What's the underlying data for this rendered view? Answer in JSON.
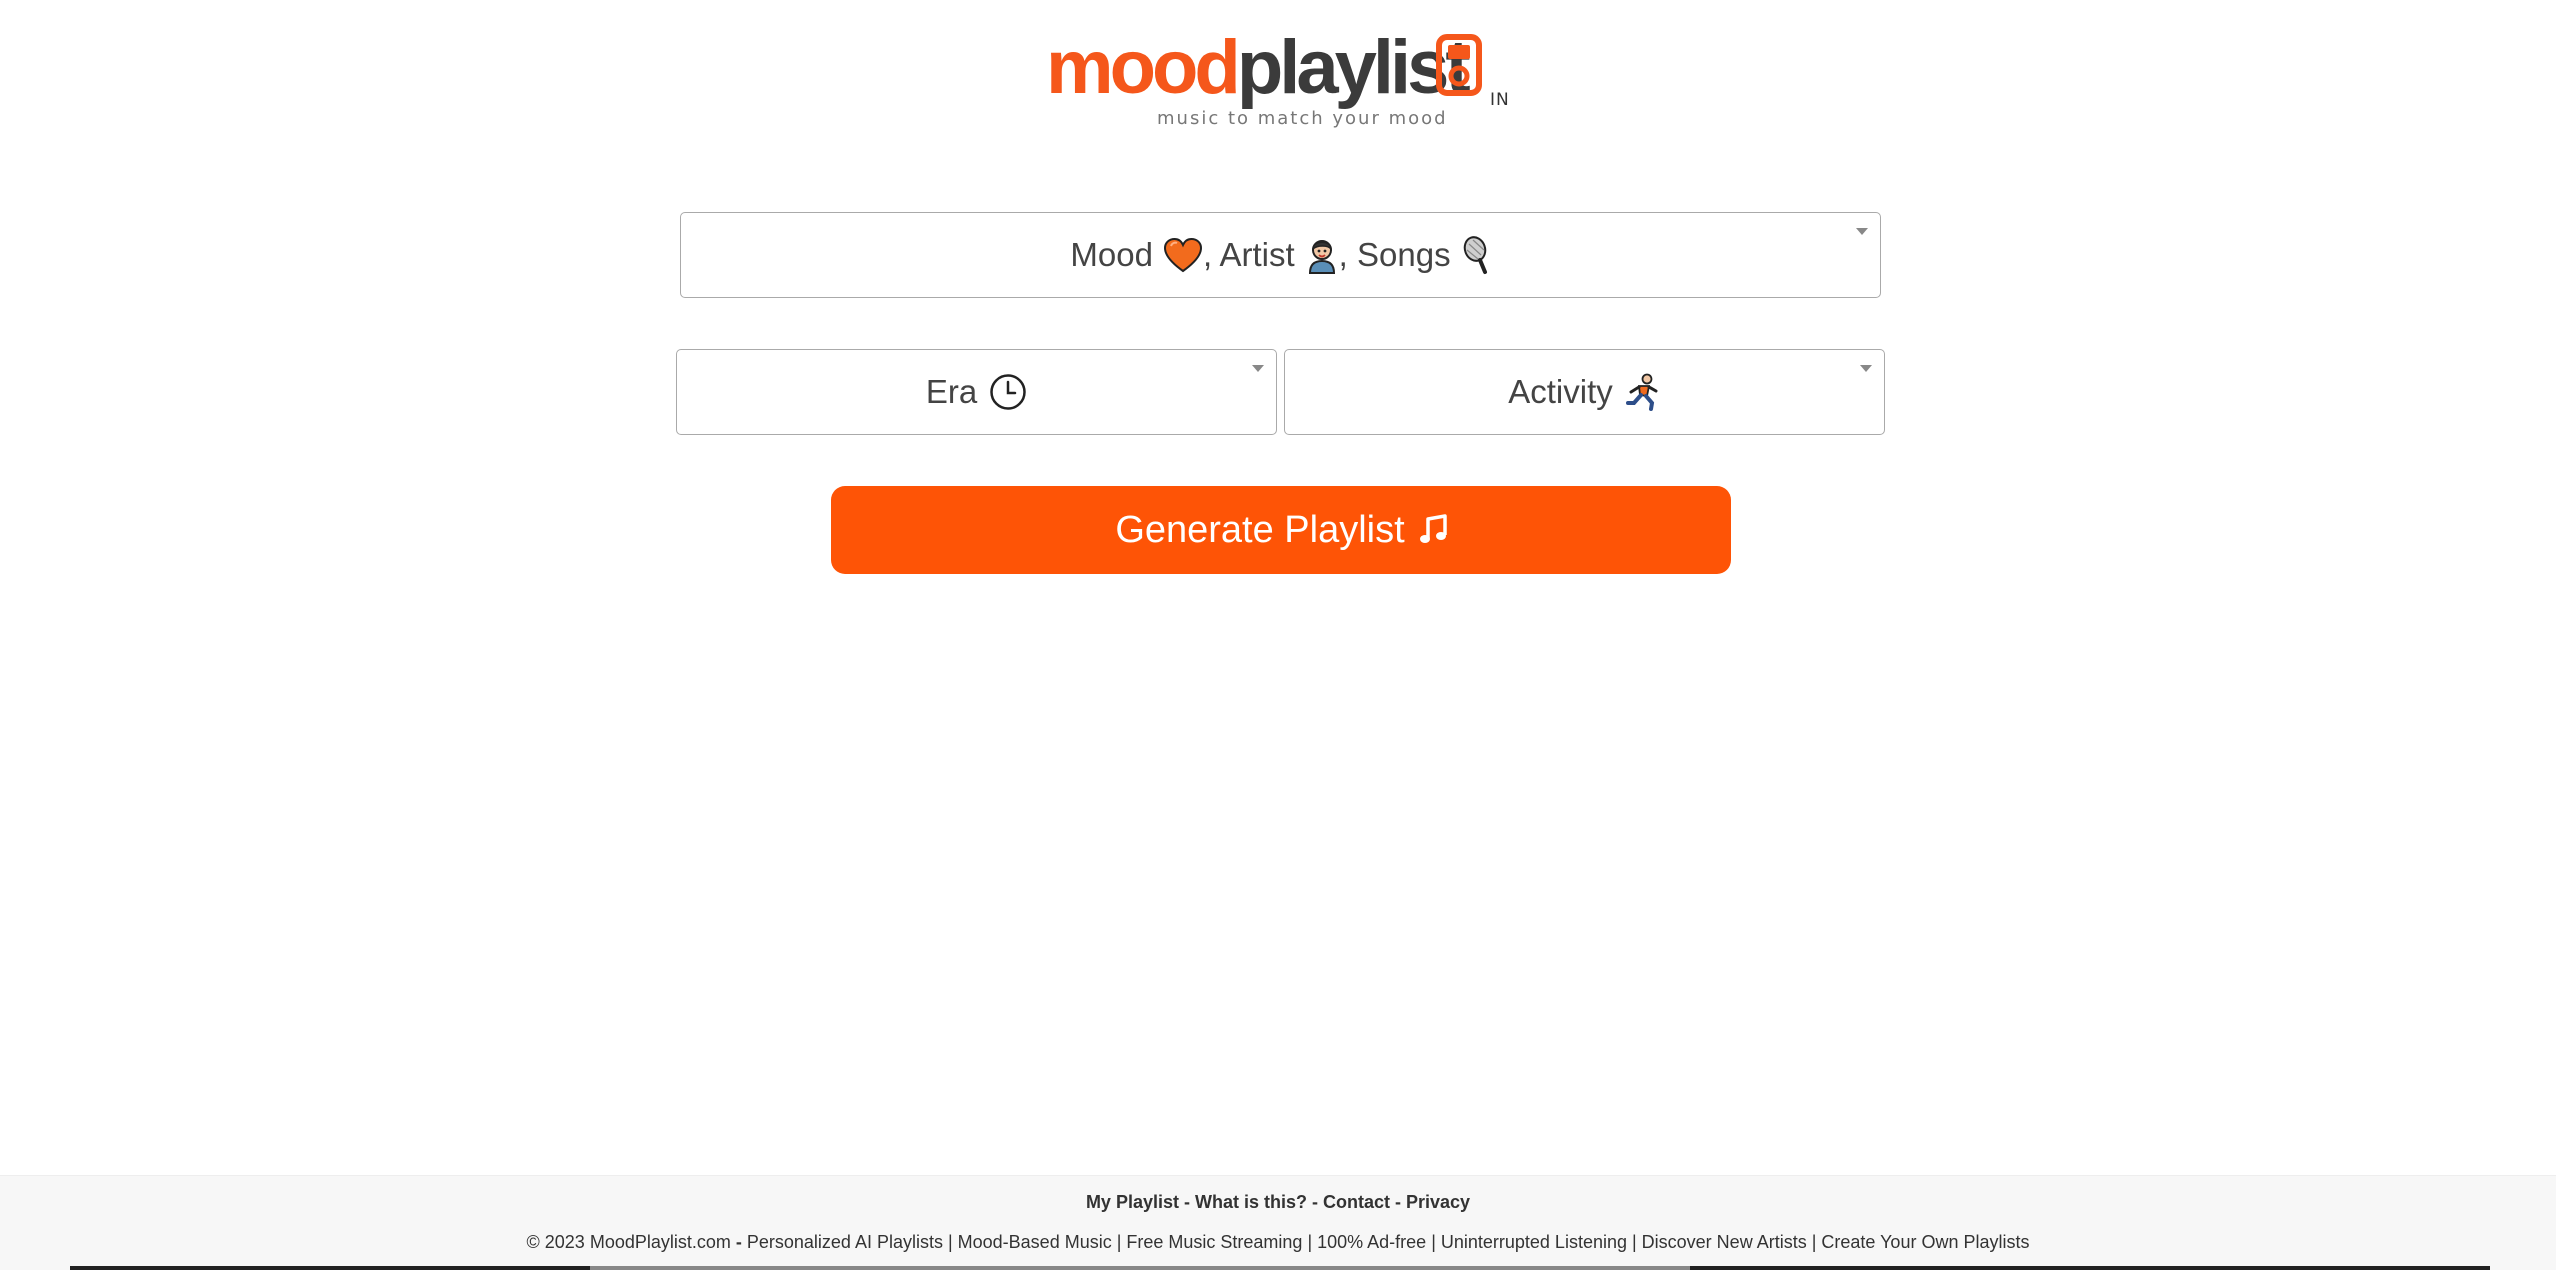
{
  "header": {
    "logo_mood": "mood",
    "logo_playlist": "playlist",
    "region": "IN",
    "tagline": "music to match your mood"
  },
  "selectors": {
    "mood": {
      "mood_label": "Mood",
      "artist_label": ", Artist",
      "songs_label": ", Songs",
      "icons": [
        "heart-icon",
        "artist-icon",
        "microphone-icon"
      ]
    },
    "era": {
      "label": "Era",
      "icon": "clock-icon"
    },
    "activity": {
      "label": "Activity",
      "icon": "running-person-icon"
    }
  },
  "generate": {
    "label": "Generate Playlist",
    "icon": "music-note-icon"
  },
  "footer": {
    "links": [
      "My Playlist",
      "What is this?",
      "Contact",
      "Privacy"
    ],
    "link_separator": " - ",
    "copyright": "© 2023 MoodPlaylist.com",
    "copy_separator": " - ",
    "features": "Personalized AI Playlists | Mood-Based Music | Free Music Streaming | 100% Ad-free | Uninterrupted Listening | Discover New Artists | Create Your Own Playlists"
  },
  "colors": {
    "brand_orange": "#fe5406",
    "logo_orange": "#f5571b",
    "logo_dark": "#3b3b3b"
  }
}
